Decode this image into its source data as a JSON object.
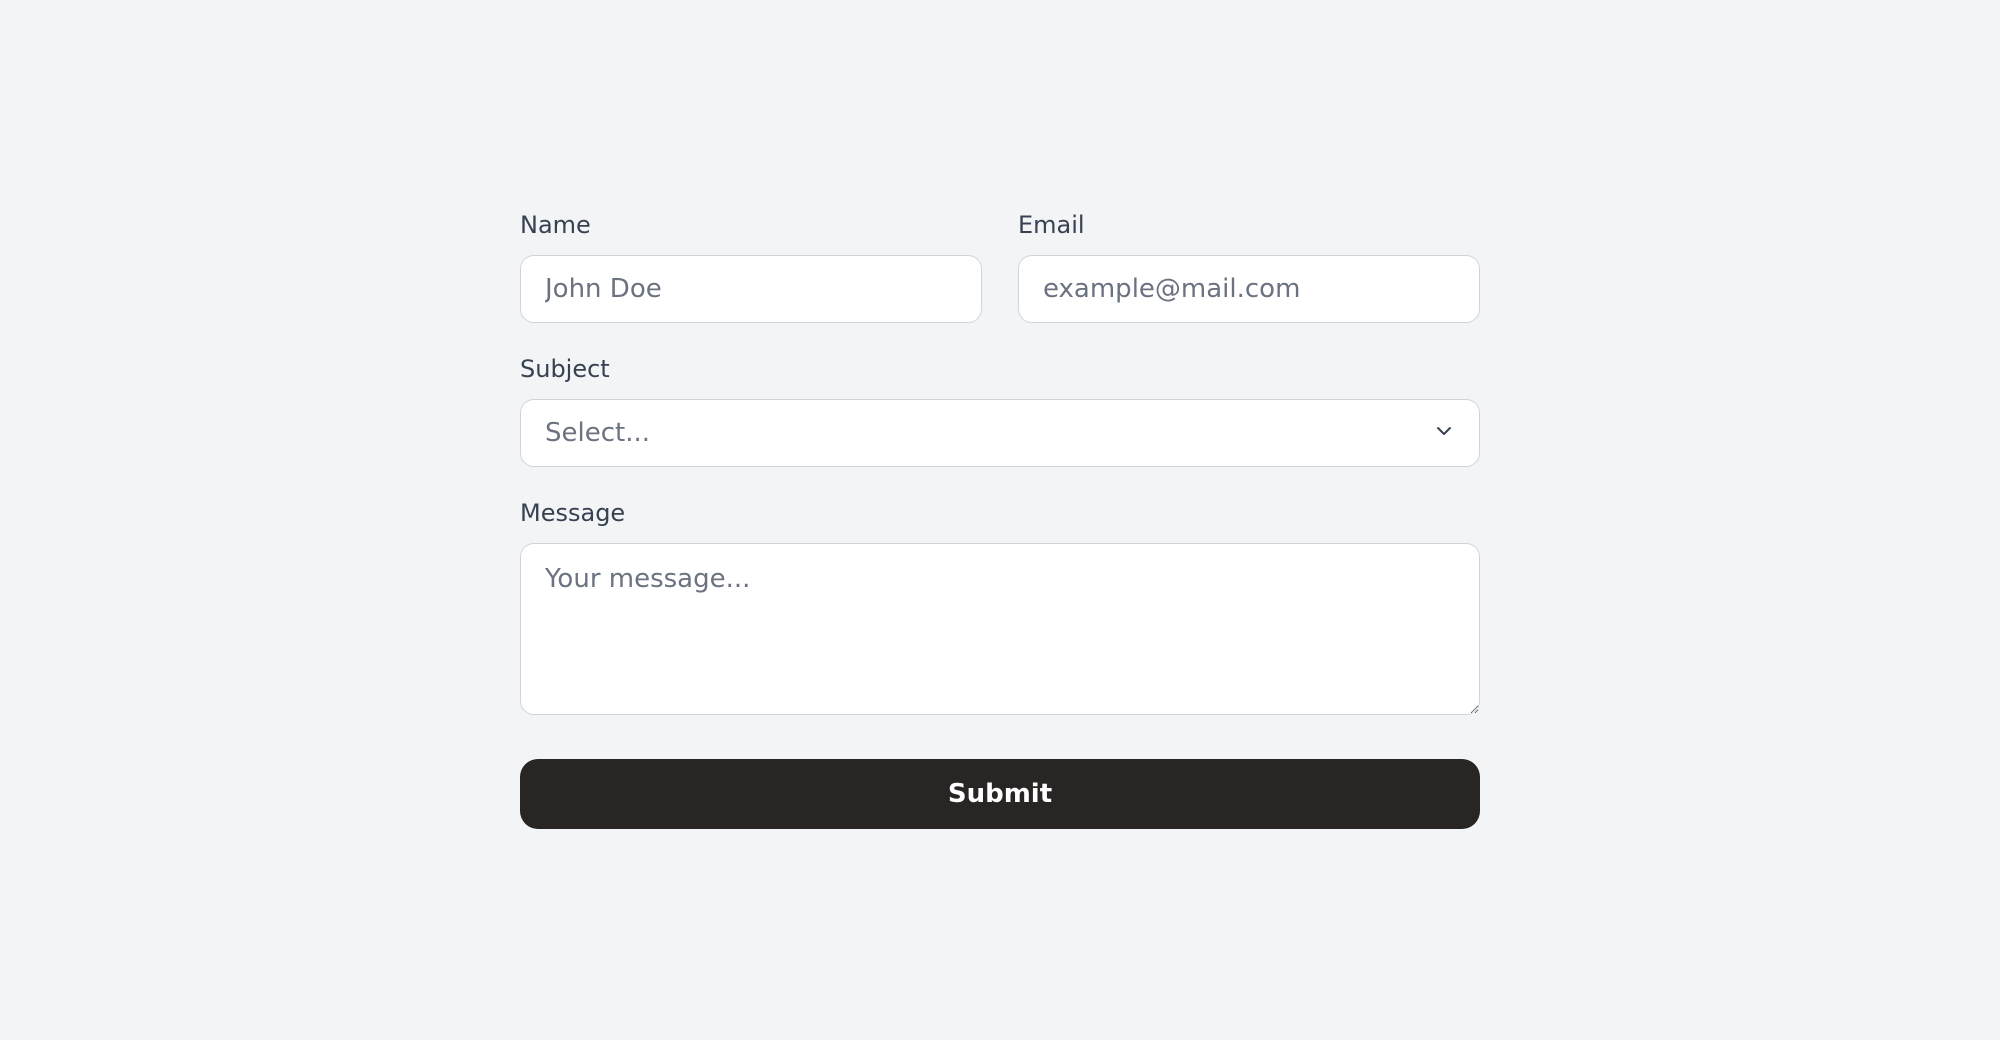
{
  "form": {
    "name": {
      "label": "Name",
      "placeholder": "John Doe",
      "value": ""
    },
    "email": {
      "label": "Email",
      "placeholder": "example@mail.com",
      "value": ""
    },
    "subject": {
      "label": "Subject",
      "selected": "Select..."
    },
    "message": {
      "label": "Message",
      "placeholder": "Your message...",
      "value": ""
    },
    "submit_label": "Submit"
  }
}
